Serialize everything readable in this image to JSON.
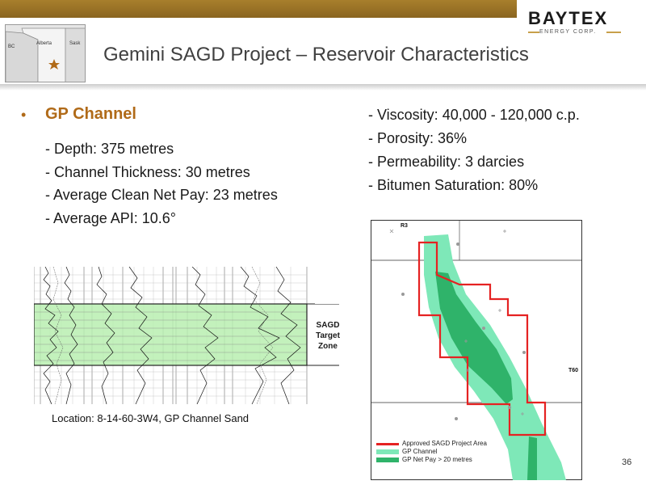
{
  "header": {
    "logo_name": "BAYTEX",
    "logo_sub": "ENERGY CORP.",
    "title": "Gemini SAGD Project – Reservoir Characteristics"
  },
  "locator_map": {
    "labels": [
      "BC",
      "Alberta",
      "Sask"
    ]
  },
  "left_section": {
    "bullet": "•",
    "heading": "GP Channel",
    "items": [
      "- Depth: 375 metres",
      "- Channel Thickness: 30 metres",
      "- Average Clean Net Pay: 23 metres",
      "- Average API: 10.6°"
    ]
  },
  "right_section": {
    "items": [
      "- Viscosity: 40,000 - 120,000 c.p.",
      "- Porosity: 36%",
      "- Permeability: 3 darcies",
      "- Bitumen Saturation: 80%"
    ]
  },
  "log_figure": {
    "zone_label": [
      "SAGD",
      "Target",
      "Zone"
    ],
    "caption": "Location: 8-14-60-3W4, GP Channel Sand"
  },
  "map_figure": {
    "range_label": "R3",
    "township_label": "T60",
    "legend": [
      {
        "label": "Approved SAGD Project Area",
        "color": "#e52222"
      },
      {
        "label": "GP Channel",
        "color": "#7ee8b8"
      },
      {
        "label": "GP Net Pay > 20 metres",
        "color": "#2fb36a"
      }
    ]
  },
  "colors": {
    "accent": "#b06a18",
    "topbar": "#9a7226",
    "channel": "#7ee8b8",
    "net_pay": "#2fb36a",
    "project_outline": "#e52222",
    "log_highlight": "#b8efb0"
  },
  "page_number": "36"
}
